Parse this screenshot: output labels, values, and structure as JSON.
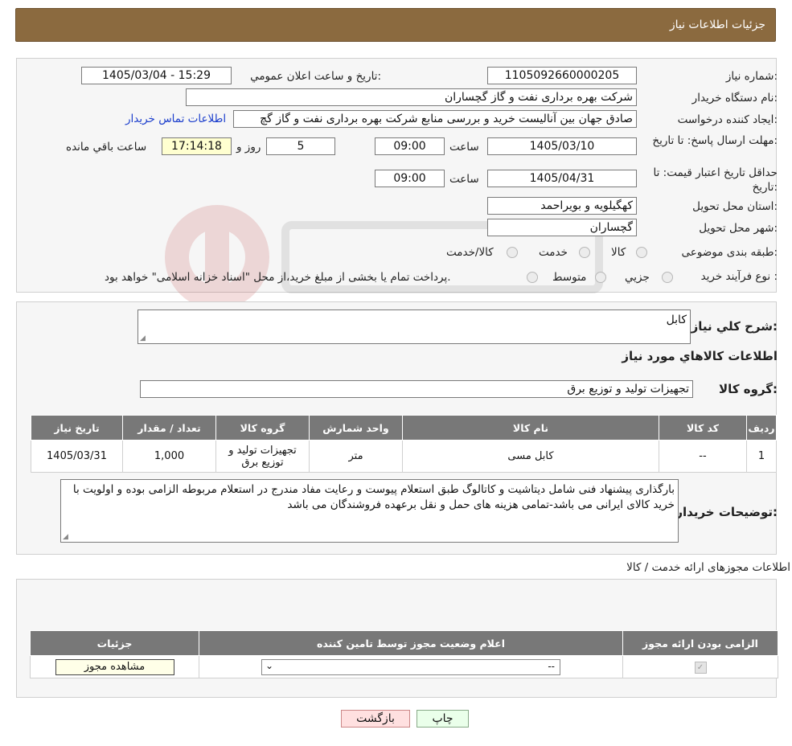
{
  "header": {
    "title": "جزئیات اطلاعات نیاز"
  },
  "form": {
    "need_number_label": "شماره نیاز:",
    "need_number": "1105092660000205",
    "announce_label": "تاريخ و ساعت اعلان عمومي:",
    "announce_value": "1405/03/04 - 15:29",
    "buyer_org_label": "نام دستگاه خريدار:",
    "buyer_org": "شرکت بهره برداری نفت و گاز گچساران",
    "creator_label": "ايجاد کننده درخواست:",
    "creator": "صادق جهان بین آنالیست خرید و بررسی منابع شرکت بهره برداری نفت و گاز گچ",
    "contact_link": "اطلاعات تماس خريدار",
    "deadline_label": "مهلت ارسال پاسخ: تا تاريخ:",
    "deadline_date": "1405/03/10",
    "time_word": "ساعت",
    "deadline_time": "09:00",
    "days_value": "5",
    "days_word": "روز و",
    "remaining_time": "17:14:18",
    "remaining_word": "ساعت باقي مانده",
    "validity_label": "حداقل تاريخ اعتبار قيمت: تا تاريخ:",
    "validity_date": "1405/04/31",
    "validity_time": "09:00",
    "province_label": "استان محل تحويل:",
    "province": "کهگیلویه و بویراحمد",
    "city_label": "شهر محل تحويل:",
    "city": "گچساران",
    "category_label": "طبقه بندی موضوعی:",
    "category_options": [
      "کالا",
      "خدمت",
      "کالا/خدمت"
    ],
    "process_label": "نوع فرآيند خريد :",
    "process_options": [
      "جزيي",
      "متوسط"
    ],
    "payment_note": "پرداخت تمام يا بخشی از مبلغ خريد،از محل \"اسناد خزانه اسلامی\" خواهد بود."
  },
  "summary": {
    "desc_label": "شرح کلي نياز:",
    "desc_value": "کابل",
    "goods_info_title": "اطلاعات کالاهاي مورد نياز",
    "group_label": "گروه کالا:",
    "group_value": "تجهیزات تولید و توزیع برق",
    "table_headers": [
      "رديف",
      "کد کالا",
      "نام کالا",
      "واحد شمارش",
      "گروه کالا",
      "تعداد / مقدار",
      "تاريخ نياز"
    ],
    "table_rows": [
      [
        "1",
        "--",
        "کابل مسی",
        "متر",
        "تجهیزات تولید و توزیع برق",
        "1,000",
        "1405/03/31"
      ]
    ],
    "buyer_notes_label": "توضيحات خريدار:",
    "buyer_notes": "بارگذاری پیشنهاد فنی شامل دیتاشیت و کاتالوگ طبق استعلام پیوست و رعایت مفاد مندرج در استعلام مربوطه الزامی بوده و اولویت با خرید کالای ایرانی می باشد-تمامی هزینه های حمل و نقل برعهده فروشندگان می باشد"
  },
  "permits": {
    "title": "اطلاعات مجوزهای ارائه خدمت / کالا",
    "headers": [
      "الزامی بودن ارائه مجوز",
      "اعلام وضعیت مجوز توسط تامین کننده",
      "جزئیات"
    ],
    "select_value": "--",
    "view_button": "مشاهده مجوز"
  },
  "footer": {
    "print_button": "چاپ",
    "back_button": "بازگشت"
  },
  "colors": {
    "header_bg": "#8b6a3f",
    "link": "#1a3dcc",
    "table_header": "#787878",
    "back_btn": "#ffe0e0",
    "print_btn": "#eaffea"
  }
}
